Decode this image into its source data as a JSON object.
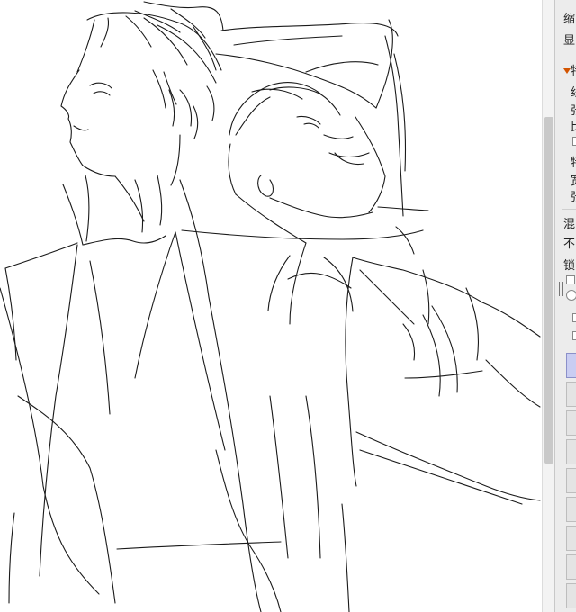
{
  "canvas": {
    "background": "#ffffff",
    "stroke_color": "#1a1a1a"
  },
  "panel": {
    "background": "#ececec",
    "accent": "#d35400",
    "labels": [
      "缩",
      "显",
      "特",
      "线",
      "张",
      "比",
      "特",
      "宽",
      "张",
      "混",
      "不",
      "锁"
    ]
  }
}
